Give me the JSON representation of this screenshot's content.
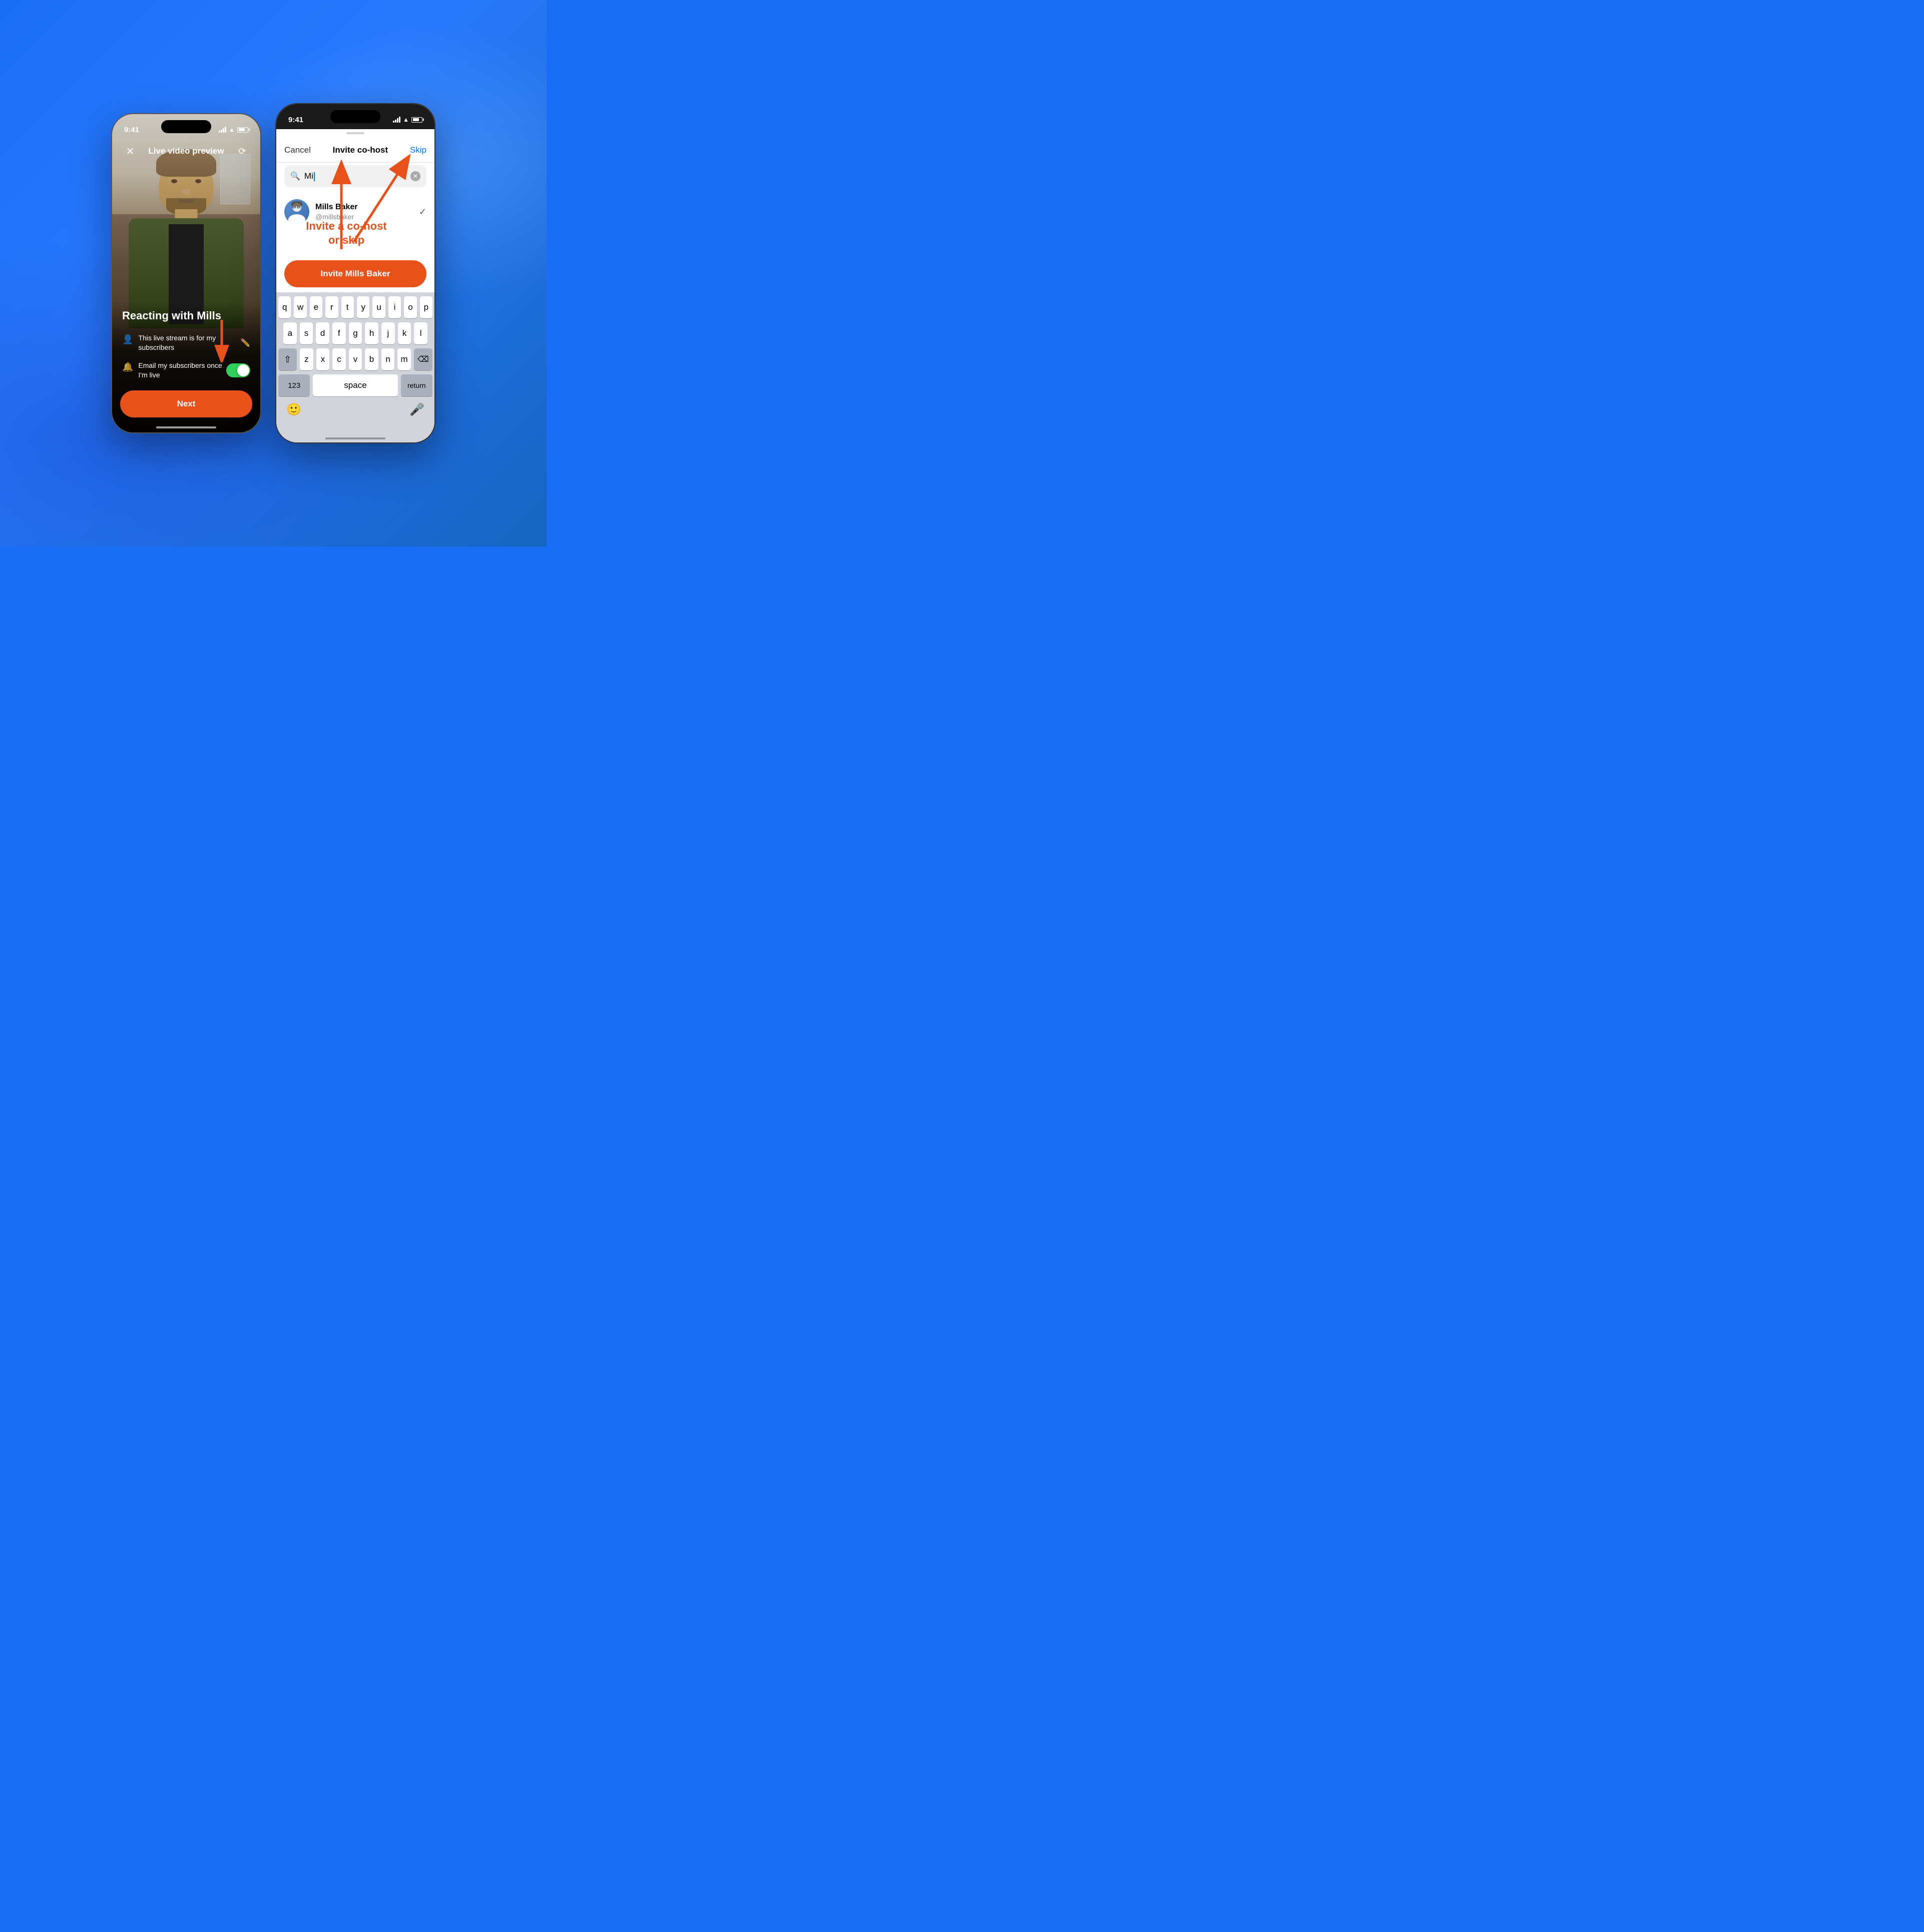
{
  "background": {
    "color": "#1a6ef5"
  },
  "phone1": {
    "status_bar": {
      "time": "9:41",
      "signal": "signal-bars",
      "wifi": "wifi-icon",
      "battery": "battery-icon"
    },
    "header": {
      "close_label": "✕",
      "title": "Live video preview",
      "camera_icon": "📷"
    },
    "body": {
      "live_title": "Reacting with Mills",
      "subscriber_text": "This live stream is for my subscribers",
      "email_text": "Email my subscribers once I'm live",
      "toggle_state": "on"
    },
    "next_button": {
      "label": "Next"
    },
    "annotation_arrow": "down"
  },
  "phone2": {
    "status_bar": {
      "time": "9:41"
    },
    "header": {
      "cancel_label": "Cancel",
      "title": "Invite co-host",
      "skip_label": "Skip"
    },
    "search": {
      "placeholder": "Mi",
      "search_icon": "search-icon"
    },
    "user_result": {
      "name": "Mills Baker",
      "handle": "@millsbaker",
      "selected": false
    },
    "invite_button": {
      "label": "Invite Mills Baker"
    },
    "annotation": {
      "line1": "Invite a co-host",
      "line2": "or skip"
    },
    "keyboard": {
      "row1": [
        "q",
        "w",
        "e",
        "r",
        "t",
        "y",
        "u",
        "i",
        "o",
        "p"
      ],
      "row2": [
        "a",
        "s",
        "d",
        "f",
        "g",
        "h",
        "j",
        "k",
        "l"
      ],
      "row3": [
        "z",
        "x",
        "c",
        "v",
        "b",
        "n",
        "m"
      ],
      "space_label": "space",
      "return_label": "return",
      "numbers_label": "123"
    }
  }
}
